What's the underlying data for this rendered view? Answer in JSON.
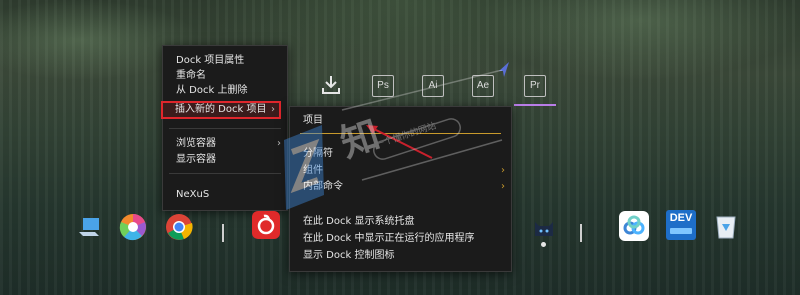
{
  "colors": {
    "highlight_box": "#e0262c",
    "arrow": "#c8202c",
    "indicator": "#b97de8",
    "menu_bg": "#1b1b1b"
  },
  "top_dock": {
    "items": [
      {
        "icon": "download-icon",
        "label": ""
      },
      {
        "icon": "photoshop-icon",
        "label": "Ps"
      },
      {
        "icon": "illustrator-icon",
        "label": "Ai"
      },
      {
        "icon": "after-effects-icon",
        "label": "Ae"
      },
      {
        "icon": "premiere-icon",
        "label": "Pr"
      }
    ]
  },
  "context_menu": {
    "items": [
      {
        "label": "Dock 项目属性"
      },
      {
        "label": "重命名"
      },
      {
        "label": "从 Dock 上删除"
      },
      {
        "label": "插入新的 Dock 项目",
        "arrow": "›"
      },
      {
        "label": "浏览容器",
        "arrow": "›"
      },
      {
        "label": "显示容器"
      },
      {
        "label": "NeXuS"
      }
    ]
  },
  "submenu": {
    "items": [
      {
        "label": "项目"
      },
      {
        "label": "分隔符"
      },
      {
        "label": "组件",
        "arrow": "›"
      },
      {
        "label": "内部命令",
        "arrow": "›"
      },
      {
        "label": "在此 Dock 显示系统托盘"
      },
      {
        "label": "在此 Dock 中显示正在运行的应用程序"
      },
      {
        "label": "显示 Dock 控制图标"
      }
    ]
  },
  "bottom_dock": {
    "items": [
      {
        "icon": "computer-icon"
      },
      {
        "icon": "color-wheel-icon"
      },
      {
        "icon": "chrome-icon"
      },
      {
        "icon": "netease-music-icon"
      },
      {
        "icon": "cat-icon"
      },
      {
        "icon": "cloud-app-icon"
      },
      {
        "icon": "dev-tools-icon",
        "label": "DEV"
      },
      {
        "icon": "recycle-bin-icon"
      }
    ]
  },
  "watermark": {
    "text": "知",
    "subtext": "一个懂你的网站"
  }
}
